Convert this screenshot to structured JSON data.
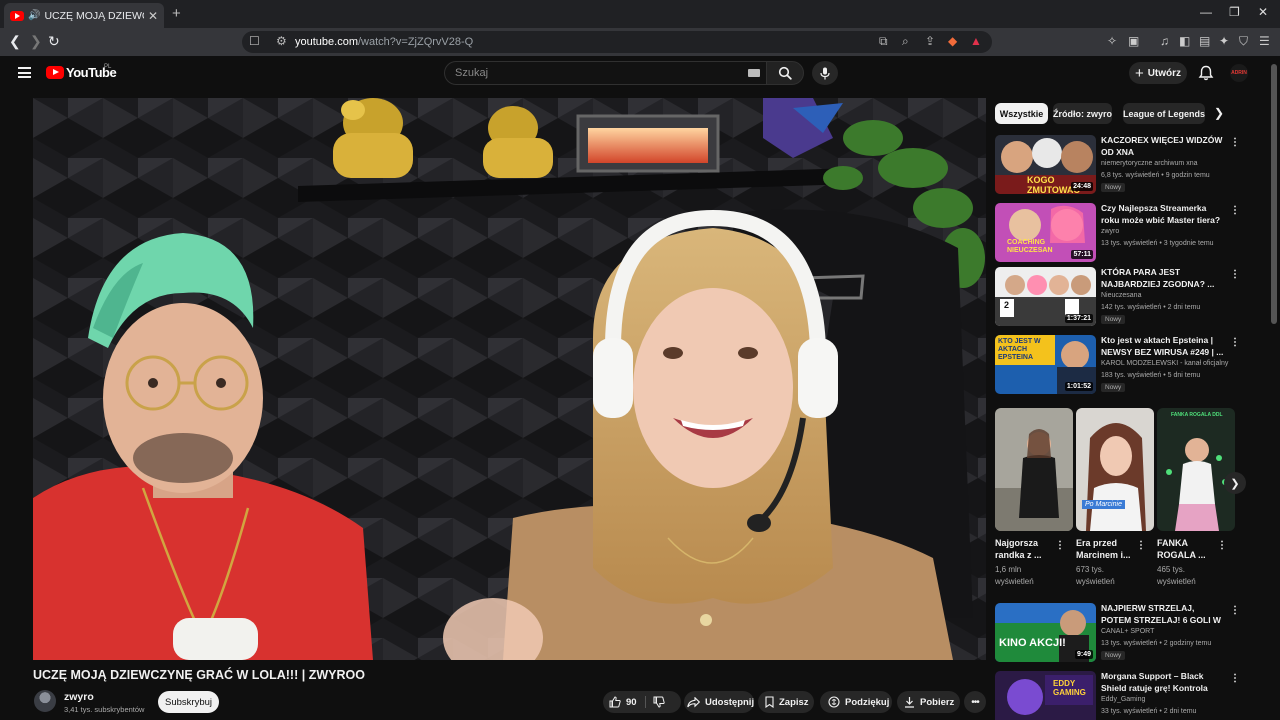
{
  "browser": {
    "tab_title": "UCZĘ MOJĄ DZIEWCZYNĘ GR",
    "url_host": "youtube.com",
    "url_path": "/watch?v=ZjZQrvV28-Q"
  },
  "masthead": {
    "logo_text": "YouTube",
    "country_code": "PL",
    "search_placeholder": "Szukaj",
    "create_label": "Utwórz",
    "avatar_text": "ADRIN"
  },
  "video": {
    "title": "UCZĘ MOJĄ DZIEWCZYNĘ GRAĆ W LOLA!!! | ZWYROO",
    "channel": "zwyro",
    "subscribers": "3,41 tys. subskrybentów",
    "subscribe_label": "Subskrybuj",
    "likes": "90",
    "share_label": "Udostępnij",
    "save_label": "Zapisz",
    "thanks_label": "Podziękuj",
    "download_label": "Pobierz"
  },
  "chips": [
    "Wszystkie",
    "Źródło: zwyro",
    "League of Legends"
  ],
  "recommendations_top": [
    {
      "title": "KACZOREX WIĘCEJ WIDZÓW OD XNA",
      "channel": "niemerytoryczne archiwum xna",
      "meta": "6,8 tys. wyświetleń • 9 godzin temu",
      "badge": "Nowy",
      "duration": "24:48",
      "thumb_text": "KOGO ZMUTOWAĆ"
    },
    {
      "title": "Czy Najlepsza Streamerka roku może wbić Master tiera?",
      "channel": "zwyro",
      "meta": "13 tys. wyświetleń • 3 tygodnie temu",
      "badge": "",
      "duration": "57:11",
      "thumb_text": "COACHING NIEUCZESAN"
    },
    {
      "title": "KTÓRA PARA JEST NAJBARDZIEJ ZGODNA? ...",
      "channel": "Nieuczesana",
      "meta": "142 tys. wyświetleń • 2 dni temu",
      "badge": "Nowy",
      "duration": "1:37:21",
      "thumb_text": "2 5"
    },
    {
      "title": "Kto jest w aktach Epsteina | NEWSY BEZ WIRUSA #249 | ...",
      "channel": "KAROL MODZELEWSKI - kanał oficjalny",
      "meta": "183 tys. wyświetleń • 5 dni temu",
      "badge": "Nowy",
      "duration": "1:01:52",
      "thumb_text": "KTO JEST W AKTACH EPSTEINA"
    }
  ],
  "shorts": [
    {
      "title": "Najgorsza randka z ...",
      "views": "1,6 mln wyświetleń"
    },
    {
      "title": "Era przed Marcinem i...",
      "views": "673 tys. wyświetleń",
      "thumb_text": "Po Marcinie"
    },
    {
      "title": "FANKA ROGALA ...",
      "views": "465 tys. wyświetleń",
      "thumb_text": "FANKA ROGALA DDL"
    }
  ],
  "recommendations_bottom": [
    {
      "title": "NAJPIERW STRZELAJ, POTEM STRZELAJ! 6 GOLI W BRUGII! ...",
      "channel": "CANAL+ SPORT",
      "meta": "13 tys. wyświetleń • 2 godziny temu",
      "badge": "Nowy",
      "duration": "9:49",
      "thumb_text": "KINO AKCJI!"
    },
    {
      "title": "Morgana Support – Black Shield ratuje grę! Kontrola botlane i ...",
      "channel": "Eddy_Gaming",
      "meta": "33 tys. wyświetleń • 2 dni temu",
      "badge": "",
      "duration": "",
      "thumb_text": "EDDY GAMING"
    }
  ],
  "colors": {
    "background": "#0f0f0f",
    "brand_red": "#ff0000",
    "chip_active": "#f1f1f1",
    "pill": "#272727"
  }
}
